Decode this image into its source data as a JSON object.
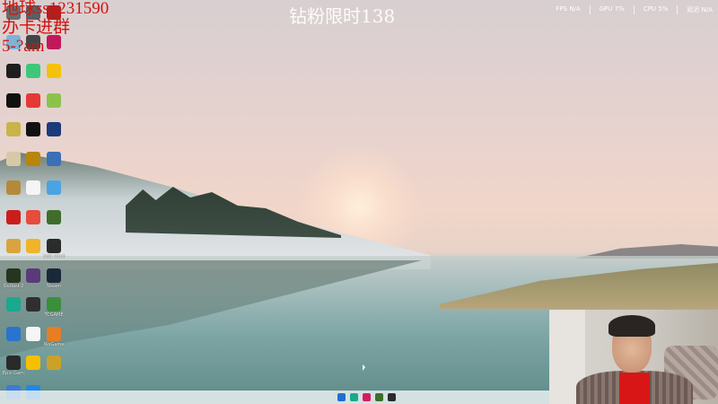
{
  "overlay": {
    "line1": "地球ss1231590",
    "line2": "办卡进群",
    "line3": "5-?am"
  },
  "banner": "钻粉限时138",
  "stats": {
    "fps": "FPS N/A",
    "gpu": "GPU 7%",
    "cpu": "CPU 5%",
    "latency": "延迟 N/A"
  },
  "desktop_icons": [
    {
      "label": "",
      "icon": "app-icon",
      "color": "#6a6a6a"
    },
    {
      "label": "",
      "icon": "app-icon",
      "color": "#5a5f66"
    },
    {
      "label": "",
      "icon": "app-icon",
      "color": "#b02020"
    },
    {
      "label": "",
      "icon": "app-icon",
      "color": "#7fb3d5"
    },
    {
      "label": "",
      "icon": "app-icon",
      "color": "#444"
    },
    {
      "label": "",
      "icon": "app-icon",
      "color": "#c2185b"
    },
    {
      "label": "",
      "icon": "app-icon",
      "color": "#1e1e1e"
    },
    {
      "label": "",
      "icon": "app-icon",
      "color": "#3ec77a"
    },
    {
      "label": "",
      "icon": "app-icon",
      "color": "#f4c20d"
    },
    {
      "label": "",
      "icon": "app-icon",
      "color": "#111"
    },
    {
      "label": "",
      "icon": "app-icon",
      "color": "#e53935"
    },
    {
      "label": "",
      "icon": "app-icon",
      "color": "#8bc34a"
    },
    {
      "label": "",
      "icon": "app-icon",
      "color": "#c8b44a"
    },
    {
      "label": "",
      "icon": "app-icon",
      "color": "#111"
    },
    {
      "label": "",
      "icon": "app-icon",
      "color": "#1b3b7a"
    },
    {
      "label": "",
      "icon": "app-icon",
      "color": "#d7c9a5"
    },
    {
      "label": "",
      "icon": "app-icon",
      "color": "#b8860b"
    },
    {
      "label": "",
      "icon": "app-icon",
      "color": "#3b6fb6"
    },
    {
      "label": "",
      "icon": "app-icon",
      "color": "#b48a3a"
    },
    {
      "label": "",
      "icon": "app-icon",
      "color": "#f5f5f5"
    },
    {
      "label": "",
      "icon": "app-icon",
      "color": "#4ba3e3"
    },
    {
      "label": "",
      "icon": "app-icon",
      "color": "#cc1d1d"
    },
    {
      "label": "",
      "icon": "app-icon",
      "color": "#e74c3c"
    },
    {
      "label": "",
      "icon": "app-icon",
      "color": "#3f6e2a"
    },
    {
      "label": "",
      "icon": "app-icon",
      "color": "#d9a440"
    },
    {
      "label": "",
      "icon": "app-icon",
      "color": "#f0b429"
    },
    {
      "label": "OBS Studio",
      "icon": "obs-icon",
      "color": "#2b2b2b"
    },
    {
      "label": "Outlast 2",
      "icon": "app-icon",
      "color": "#25351f"
    },
    {
      "label": "",
      "icon": "app-icon",
      "color": "#5b3a7a"
    },
    {
      "label": "Steam",
      "icon": "steam-icon",
      "color": "#1b2838"
    },
    {
      "label": "",
      "icon": "edge-icon",
      "color": "#1aa88f"
    },
    {
      "label": "",
      "icon": "app-icon",
      "color": "#2f2f2f"
    },
    {
      "label": "TCGAME",
      "icon": "app-icon",
      "color": "#3a8f3a"
    },
    {
      "label": "",
      "icon": "app-icon",
      "color": "#2a74d0"
    },
    {
      "label": "",
      "icon": "file-icon",
      "color": "#f5f5f5"
    },
    {
      "label": "WeGame",
      "icon": "app-icon",
      "color": "#e67e22"
    },
    {
      "label": "Epic Games Launcher",
      "icon": "epic-icon",
      "color": "#2a2a2a"
    },
    {
      "label": "",
      "icon": "app-icon",
      "color": "#f5c000"
    },
    {
      "label": "",
      "icon": "app-icon",
      "color": "#c9a227"
    },
    {
      "label": "",
      "icon": "app-icon",
      "color": "#3d7bd6"
    },
    {
      "label": "",
      "icon": "app-icon",
      "color": "#1e88e5"
    }
  ],
  "taskbar": {
    "items": [
      {
        "icon": "windows-start-icon",
        "color": "#1f6fd1"
      },
      {
        "icon": "edge-icon",
        "color": "#1aa88f"
      },
      {
        "icon": "app-icon",
        "color": "#d81b60"
      },
      {
        "icon": "app-icon",
        "color": "#3f6e2a"
      },
      {
        "icon": "app-icon",
        "color": "#2b2b2b"
      }
    ]
  }
}
